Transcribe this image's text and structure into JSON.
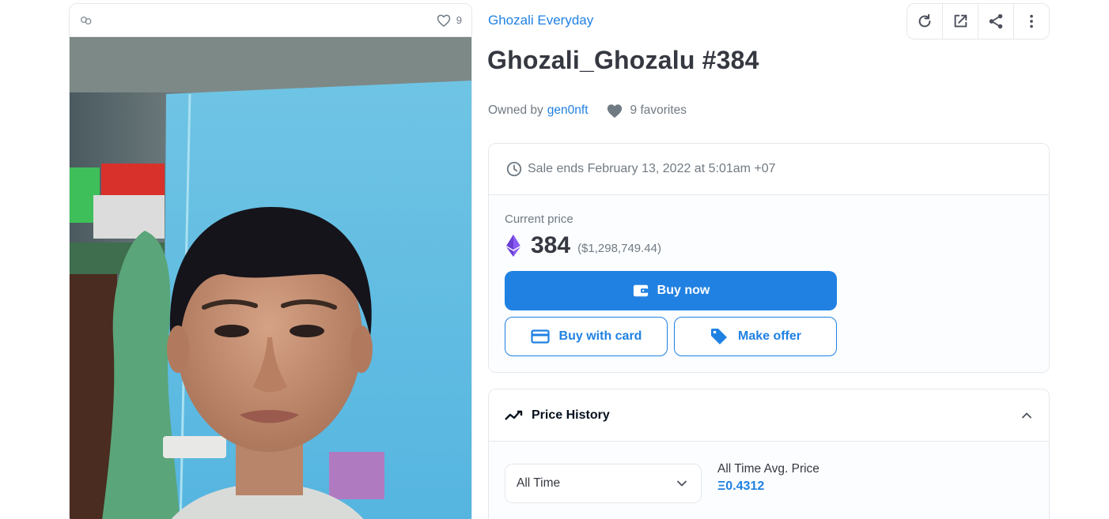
{
  "image_card": {
    "favorite_count": "9"
  },
  "collection": {
    "name": "Ghozali Everyday"
  },
  "toolbar": {
    "buttons": [
      "refresh-icon",
      "external-link-icon",
      "share-icon",
      "more-vertical-icon"
    ]
  },
  "asset": {
    "title": "Ghozali_Ghozalu #384"
  },
  "ownership": {
    "owned_by_label": "Owned by",
    "owner": "gen0nft",
    "favorites": "9 favorites"
  },
  "trade": {
    "sale_ends": "Sale ends February 13, 2022 at 5:01am +07",
    "current_price_label": "Current price",
    "price": "384",
    "price_usd": "($1,298,749.44)",
    "buy_now_label": "Buy now",
    "buy_with_card_label": "Buy with card",
    "make_offer_label": "Make offer"
  },
  "price_history": {
    "title": "Price History",
    "period_selected": "All Time",
    "avg_label": "All Time Avg. Price",
    "avg_value": "Ξ0.4312"
  },
  "colors": {
    "accent": "#2081e2",
    "text": "#353840",
    "muted": "#707a83",
    "border": "#e5e8eb",
    "eth_purple": "#8a5cf6"
  }
}
